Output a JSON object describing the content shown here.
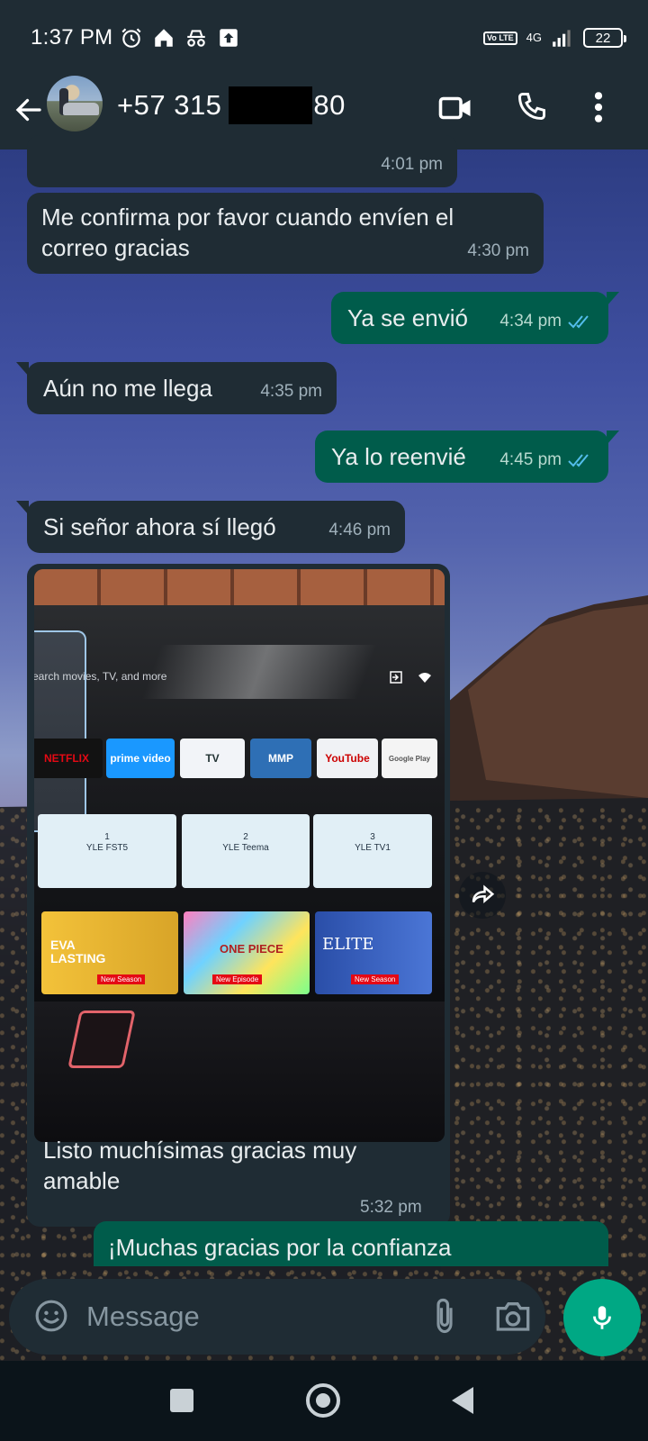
{
  "status_bar": {
    "time": "1:37 PM",
    "network_volte": "Vo LTE",
    "network_type": "4G",
    "battery": "22"
  },
  "header": {
    "contact_prefix": "+57 315",
    "contact_suffix": "80",
    "icons": [
      "back-arrow-icon",
      "video-call-icon",
      "voice-call-icon",
      "more-options-icon"
    ]
  },
  "messages": [
    {
      "direction": "in",
      "text": "",
      "time": "4:01 pm"
    },
    {
      "direction": "in",
      "text": "Me confirma por favor cuando envíen el correo gracias",
      "time": "4:30 pm"
    },
    {
      "direction": "out",
      "text": "Ya se envió",
      "time": "4:34 pm",
      "status": "read"
    },
    {
      "direction": "in",
      "text": "Aún no me llega",
      "time": "4:35 pm"
    },
    {
      "direction": "out",
      "text": "Ya lo reenvié",
      "time": "4:45 pm",
      "status": "read"
    },
    {
      "direction": "in",
      "text": "Si señor ahora sí llegó",
      "time": "4:46 pm"
    },
    {
      "direction": "in",
      "type": "image",
      "caption": "Listo muchísimas gracias muy amable",
      "time": "5:32 pm"
    },
    {
      "direction": "out",
      "text": "¡Muchas gracias por la confianza",
      "time": ""
    }
  ],
  "tv_photo": {
    "search_text": "Search movies, TV, and more",
    "apps": [
      "NETFLIX",
      "prime video",
      "TV",
      "MMP",
      "YouTube",
      "Google Play"
    ],
    "channels": [
      {
        "number": "1",
        "name": "YLE FST5"
      },
      {
        "number": "2",
        "name": "YLE Teema"
      },
      {
        "number": "3",
        "name": "YLE TV1"
      }
    ],
    "shows": [
      {
        "title": "EVA LASTING",
        "badge": "New Season"
      },
      {
        "title": "ONE PIECE",
        "badge": "New Episode"
      },
      {
        "title": "ELITE",
        "badge": "New Season"
      }
    ]
  },
  "input": {
    "placeholder": "Message"
  },
  "colors": {
    "incoming_bubble": "#1f2c34",
    "outgoing_bubble": "#005c4b",
    "accent": "#00a884",
    "read_ticks": "#53bdeb"
  }
}
